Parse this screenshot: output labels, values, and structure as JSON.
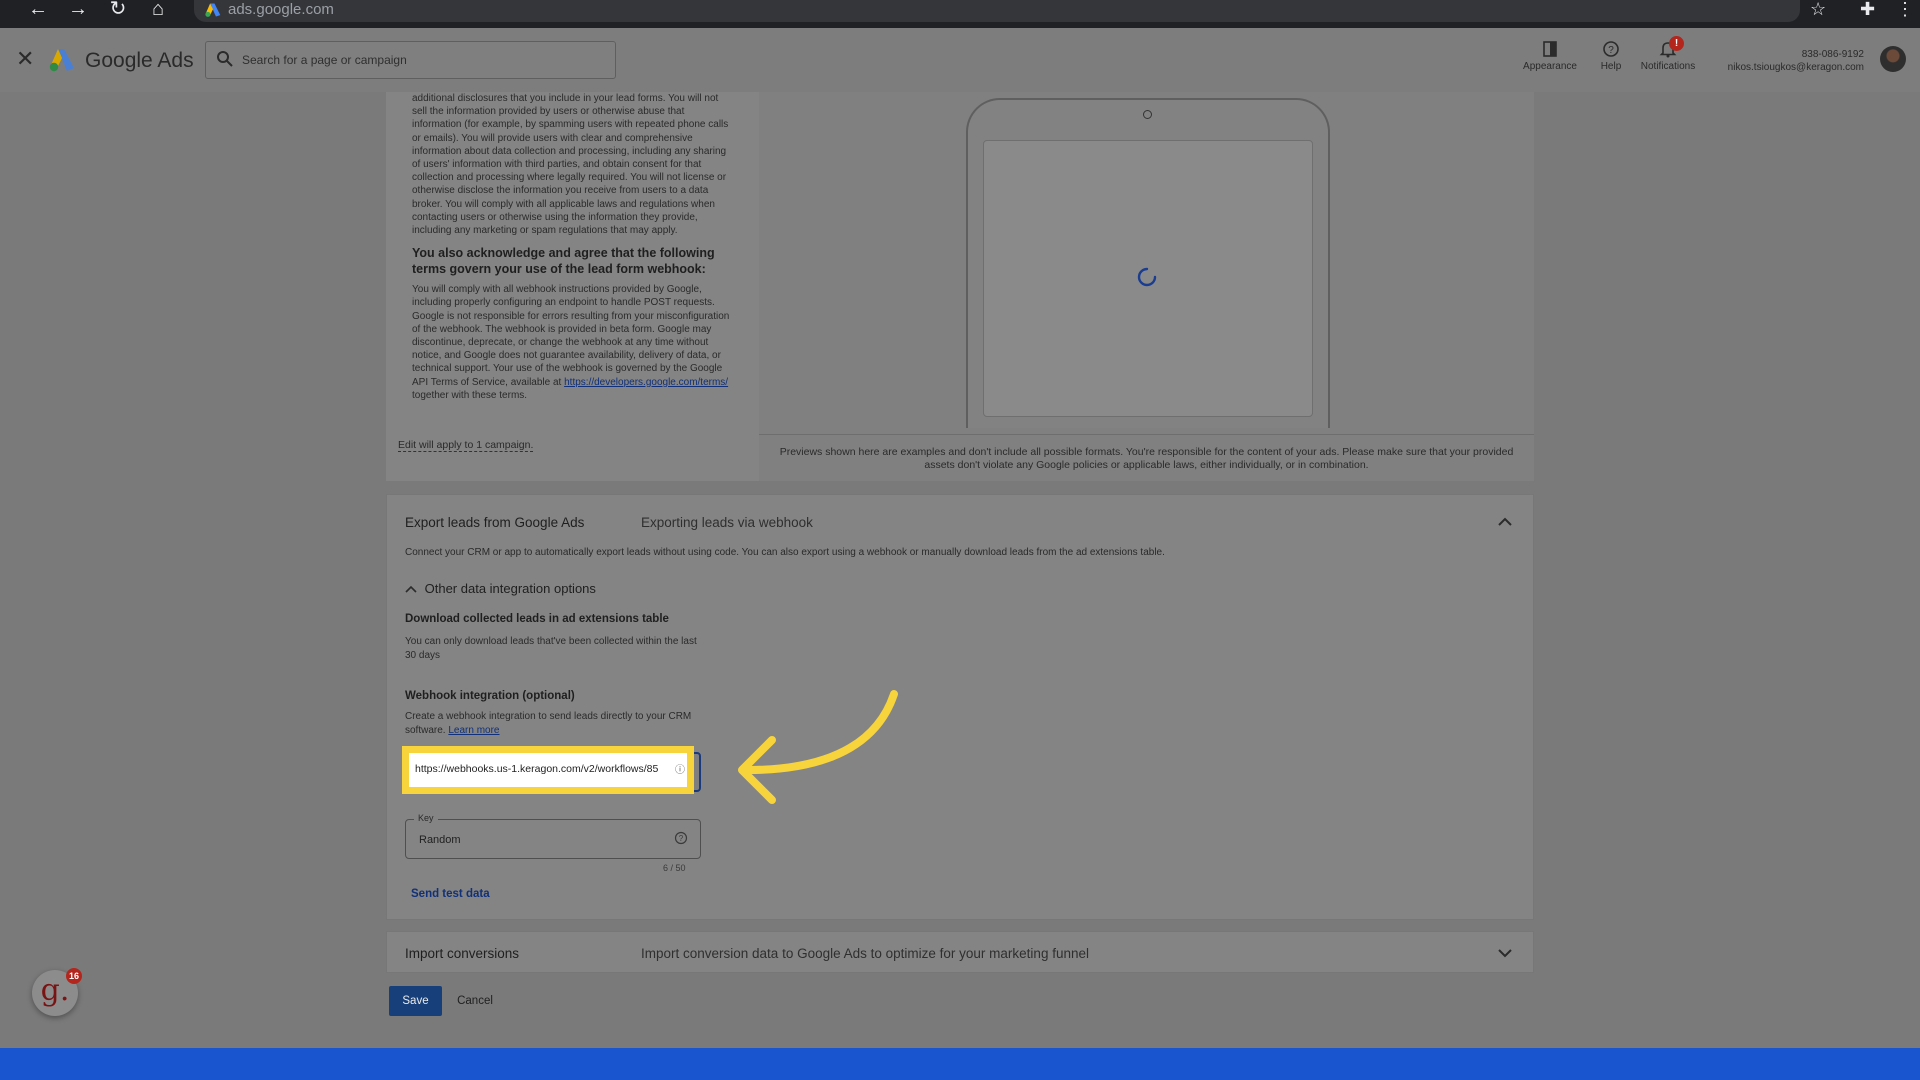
{
  "browser": {
    "url": "ads.google.com"
  },
  "header": {
    "app_name": "Google Ads",
    "search_placeholder": "Search for a page or campaign",
    "appearance_label": "Appearance",
    "help_label": "Help",
    "notifications_label": "Notifications",
    "notifications_count": "!",
    "account_phone": "838-086-9192",
    "account_email": "nikos.tsiougkos@keragon.com"
  },
  "terms": {
    "paragraph1": "additional disclosures that you include in your lead forms. You will not sell the information provided by users or otherwise abuse that information (for example, by spamming users with repeated phone calls or emails). You will provide users with clear and comprehensive information about data collection and processing, including any sharing of users' information with third parties, and obtain consent for that collection and processing where legally required. You will not license or otherwise disclose the information you receive from users to a data broker. You will comply with all applicable laws and regulations when contacting users or otherwise using the information they provide, including any marketing or spam regulations that may apply.",
    "heading": "You also acknowledge and agree that the following terms govern your use of the lead form webhook:",
    "paragraph2": "You will comply with all webhook instructions provided by Google, including properly configuring an endpoint to handle POST requests. Google is not responsible for errors resulting from your misconfiguration of the webhook. The webhook is provided in beta form. Google may discontinue, deprecate, or change the webhook at any time without notice, and Google does not guarantee availability, delivery of data, or technical support. Your use of the webhook is governed by the Google API Terms of Service, available at",
    "link": "https://developers.google.com/terms/",
    "paragraph2_end": "together with these terms.",
    "edit_note": "Edit will apply to 1 campaign."
  },
  "preview": {
    "note": "Previews shown here are examples and don't include all possible formats. You're responsible for the content of your ads. Please make sure that your provided assets don't violate any Google policies or applicable laws, either individually, or in combination."
  },
  "export": {
    "title": "Export leads from Google Ads",
    "subtitle": "Exporting leads via webhook",
    "description": "Connect your CRM or app to automatically export leads without using code. You can also export using a webhook or manually download leads from the ad extensions table.",
    "other_options_label": "Other data integration options",
    "download_heading": "Download collected leads in ad extensions table",
    "download_text": "You can only download leads that've been collected within the last 30 days",
    "webhook_heading": "Webhook integration (optional)",
    "webhook_text": "Create a webhook integration to send leads directly to your CRM software.",
    "learn_more": "Learn more",
    "webhook_url_value": "https://webhooks.us-1.keragon.com/v2/workflows/85",
    "key_label": "Key",
    "key_value": "Random",
    "key_counter": "6 / 50",
    "send_test": "Send test data"
  },
  "import": {
    "title": "Import conversions",
    "subtitle": "Import conversion data to Google Ads to optimize for your marketing funnel"
  },
  "actions": {
    "save": "Save",
    "cancel": "Cancel"
  },
  "widget": {
    "glyph": "g.",
    "count": "16"
  },
  "colors": {
    "highlight": "#f7d43b",
    "primary": "#17407a",
    "bottom_bar": "#1a55d0",
    "badge": "#b3261e"
  }
}
